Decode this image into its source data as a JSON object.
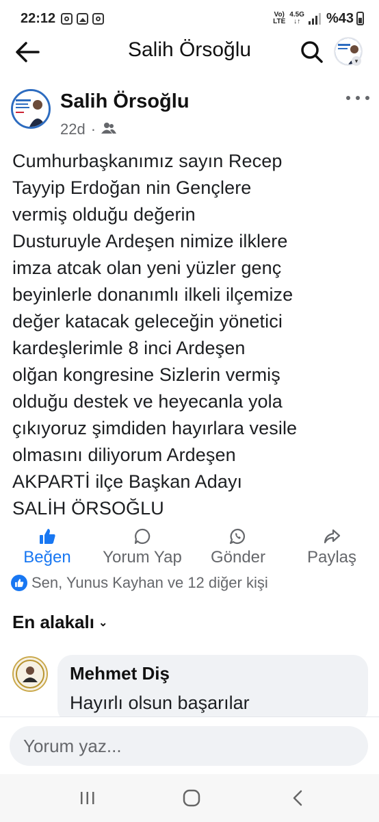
{
  "status_bar": {
    "time": "22:12",
    "network_top": "Vo)",
    "network_bottom": "LTE",
    "net_type": "4.5G",
    "battery": "%43"
  },
  "header": {
    "title": "Salih Örsoğlu"
  },
  "post": {
    "author": "Salih Örsoğlu",
    "age": "22d",
    "audience_icon": "friends-icon",
    "text": "Cumhurbaşkanımız sayın Recep\nTayyip Erdoğan  nin Gençlere\nvermiş  olduğu  değerin\nDusturuyle Ardeşen nimize ilklere\nimza   atcak olan yeni yüzler genç\nbeyinlerle donanımlı ilkeli ilçemize\ndeğer  katacak geleceğin yönetici\nkardeşlerimle  8 inci Ardeşen\nolğan kongresine Sizlerin vermiş\nolduğu  destek ve  heyecanla yola\nçıkıyoruz şimdiden hayırlara  vesile\nolmasını diliyorum   Ardeşen\nAKPARTİ ilçe  Başkan  Adayı\nSALİH  ÖRSOĞLU"
  },
  "actions": {
    "like": "Beğen",
    "comment": "Yorum Yap",
    "send": "Gönder",
    "share": "Paylaş"
  },
  "reactions": {
    "summary": "Sen, Yunus Kayhan ve 12 diğer kişi"
  },
  "comments": {
    "sort_label": "En alakalı",
    "items": [
      {
        "author": "Mehmet Diş",
        "text": "Hayırlı olsun başarılar"
      }
    ]
  },
  "composer": {
    "placeholder": "Yorum yaz..."
  },
  "colors": {
    "accent": "#1877f2",
    "secondary_text": "#65676b",
    "bubble": "#f0f2f5"
  }
}
